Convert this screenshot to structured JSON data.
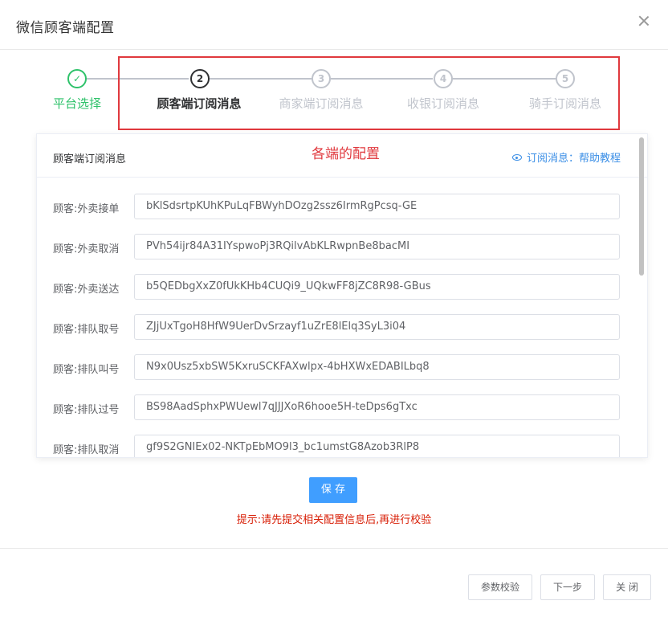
{
  "dialog": {
    "title": "微信顾客端配置"
  },
  "steps": [
    {
      "number": "✓",
      "label": "平台选择",
      "state": "done"
    },
    {
      "number": "2",
      "label": "顾客端订阅消息",
      "state": "active"
    },
    {
      "number": "3",
      "label": "商家端订阅消息",
      "state": "pending"
    },
    {
      "number": "4",
      "label": "收银订阅消息",
      "state": "pending"
    },
    {
      "number": "5",
      "label": "骑手订阅消息",
      "state": "pending"
    }
  ],
  "annotation": "各端的配置",
  "panel": {
    "title": "顾客端订阅消息",
    "help_link": "订阅消息：帮助教程",
    "fields": [
      {
        "label": "顾客:外卖接单",
        "value": "bKlSdsrtpKUhKPuLqFBWyhDOzg2ssz6IrmRgPcsq-GE"
      },
      {
        "label": "顾客:外卖取消",
        "value": "PVh54ijr84A31IYspwoPj3RQilvAbKLRwpnBe8bacMI"
      },
      {
        "label": "顾客:外卖送达",
        "value": "b5QEDbgXxZ0fUkKHb4CUQi9_UQkwFF8jZC8R98-GBus"
      },
      {
        "label": "顾客:排队取号",
        "value": "ZJjUxTgoH8HfW9UerDvSrzayf1uZrE8lElq3SyL3i04"
      },
      {
        "label": "顾客:排队叫号",
        "value": "N9x0Usz5xbSW5KxruSCKFAXwlpx-4bHXWxEDABILbq8"
      },
      {
        "label": "顾客:排队过号",
        "value": "BS98AadSphxPWUewl7qJJJXoR6hooe5H-teDps6gTxc"
      },
      {
        "label": "顾客:排队取消",
        "value": "gf9S2GNIEx02-NKTpEbMO9l3_bc1umstG8Azob3RlP8"
      }
    ]
  },
  "save_button": "保 存",
  "hint": "提示:请先提交相关配置信息后,再进行校验",
  "footer": {
    "check_button": "参数校验",
    "next_button": "下一步",
    "close_button": "关 闭"
  }
}
